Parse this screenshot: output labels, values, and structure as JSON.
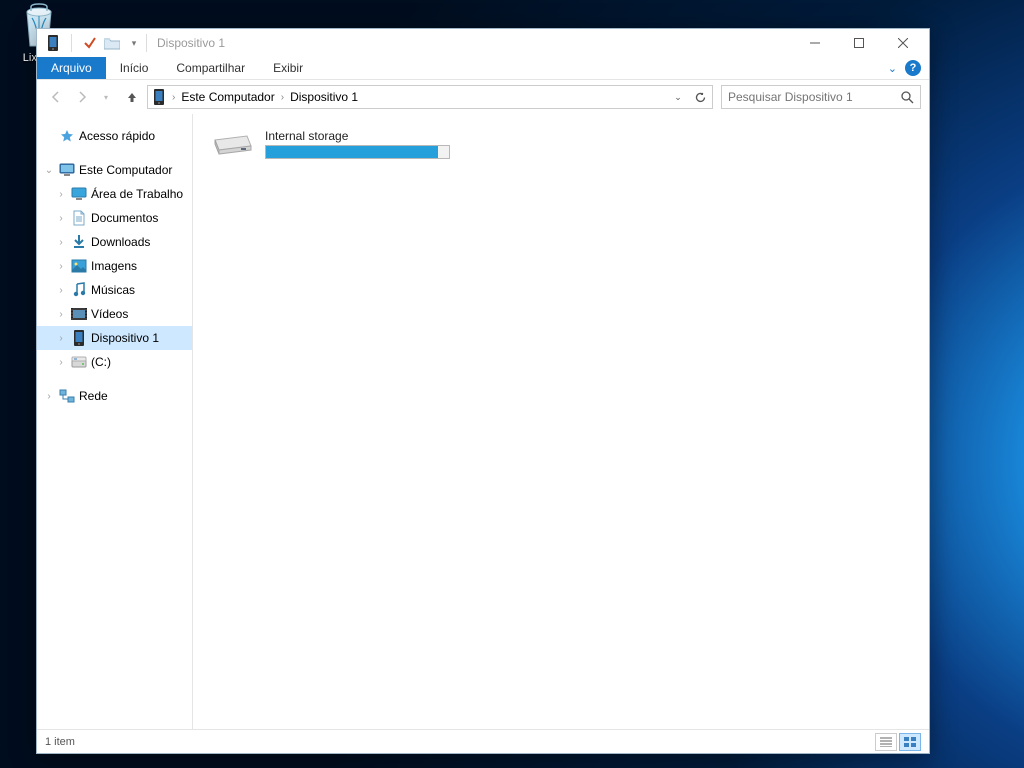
{
  "desktop": {
    "recycle_bin_label": "Lixeira"
  },
  "window": {
    "title": "Dispositivo 1",
    "ribbon": {
      "file": "Arquivo",
      "tabs": [
        "Início",
        "Compartilhar",
        "Exibir"
      ]
    },
    "breadcrumbs": [
      "Este Computador",
      "Dispositivo 1"
    ],
    "search_placeholder": "Pesquisar Dispositivo 1",
    "tree": {
      "quick_access": "Acesso rápido",
      "this_pc": "Este Computador",
      "this_pc_children": [
        {
          "label": "Área de Trabalho",
          "icon": "desktop"
        },
        {
          "label": "Documentos",
          "icon": "documents"
        },
        {
          "label": "Downloads",
          "icon": "downloads"
        },
        {
          "label": "Imagens",
          "icon": "pictures"
        },
        {
          "label": "Músicas",
          "icon": "music"
        },
        {
          "label": "Vídeos",
          "icon": "videos"
        },
        {
          "label": "Dispositivo 1",
          "icon": "device",
          "selected": true
        },
        {
          "label": "(C:)",
          "icon": "drive"
        }
      ],
      "network": "Rede"
    },
    "content": {
      "items": [
        {
          "name": "Internal storage",
          "fill_percent": 94
        }
      ]
    },
    "status": {
      "count_text": "1 item"
    }
  },
  "colors": {
    "accent": "#1979ca",
    "progress": "#26a0da",
    "selection": "#cde8ff"
  }
}
